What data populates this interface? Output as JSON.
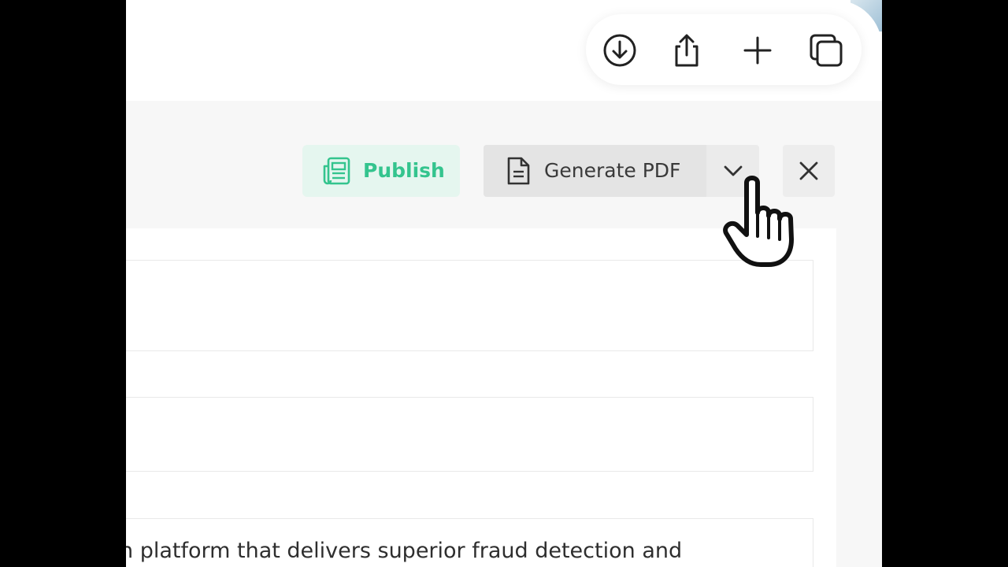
{
  "browser_toolbar": {
    "icons": [
      "download-icon",
      "share-icon",
      "plus-icon",
      "tabs-icon"
    ]
  },
  "editor_toolbar": {
    "publish_label": "Publish",
    "generate_pdf_label": "Generate PDF",
    "icons": {
      "publish": "newspaper-icon",
      "generate_pdf": "document-icon",
      "dropdown": "chevron-down-icon",
      "close": "close-icon"
    }
  },
  "content": {
    "body_text": "n platform that delivers superior fraud detection and"
  },
  "colors": {
    "publish_bg": "#e5f6ef",
    "publish_text": "#34c48e",
    "generate_bg": "#e4e4e4",
    "page_bg": "#f7f7f7"
  }
}
